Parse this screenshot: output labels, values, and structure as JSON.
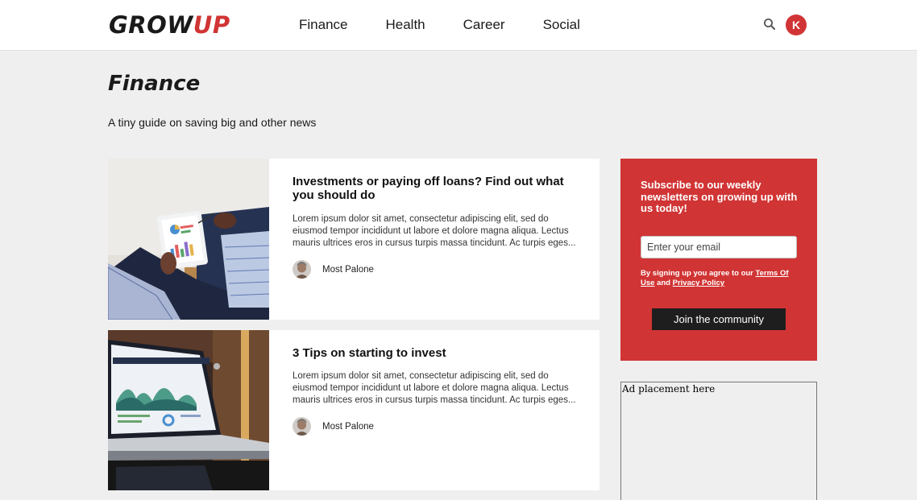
{
  "brand": {
    "part1": "GROW",
    "part2": "UP",
    "accent": "#d13434"
  },
  "nav": {
    "items": [
      "Finance",
      "Health",
      "Career",
      "Social"
    ]
  },
  "header": {
    "search_icon": "search-icon",
    "avatar_initial": "K"
  },
  "page": {
    "title": "Finance",
    "subtitle": "A tiny guide on saving big and other news"
  },
  "articles": [
    {
      "title": "Investments or paying off loans? Find out what you should do",
      "excerpt": "Lorem ipsum dolor sit amet, consectetur adipiscing elit, sed do eiusmod tempor incididunt ut labore et dolore magna aliqua. Lectus mauris ultrices eros in cursus turpis massa tincidunt. Ac turpis eges...",
      "author": "Most Palone"
    },
    {
      "title": "3 Tips on starting to invest",
      "excerpt": "Lorem ipsum dolor sit amet, consectetur adipiscing elit, sed do eiusmod tempor incididunt ut labore et dolore magna aliqua. Lectus mauris ultrices eros in cursus turpis massa tincidunt. Ac turpis eges...",
      "author": "Most Palone"
    }
  ],
  "subscribe": {
    "heading": "Subscribe to our weekly newsletters on growing up with us today!",
    "email_placeholder": "Enter your email",
    "terms_prefix": "By signing up you agree to our ",
    "terms_link": "Terms Of Use",
    "terms_and": " and ",
    "privacy_link": "Privacy Policy",
    "button": "Join the community"
  },
  "ad": {
    "label": "Ad placement here"
  }
}
